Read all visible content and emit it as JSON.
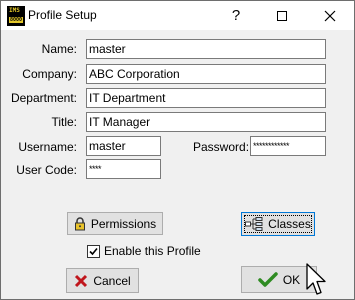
{
  "window": {
    "title": "Profile Setup",
    "icon": "ims-app-icon",
    "icon_text_top": "IMS",
    "icon_text_bottom": "8000"
  },
  "titlebar": {
    "help_label": "?",
    "minimize": "minimize-icon",
    "maximize": "maximize-icon",
    "close": "close-icon"
  },
  "form": {
    "name_label": "Name:",
    "name_value": "master",
    "company_label": "Company:",
    "company_value": "ABC Corporation",
    "department_label": "Department:",
    "department_value": "IT Department",
    "title_label": "Title:",
    "title_value": "IT Manager",
    "username_label": "Username:",
    "username_value": "master",
    "password_label": "Password:",
    "password_value": "************",
    "usercode_label": "User Code:",
    "usercode_value": "****"
  },
  "buttons": {
    "permissions_label": "Permissions",
    "classes_label": "Classes",
    "cancel_label": "Cancel",
    "ok_label": "OK"
  },
  "options": {
    "enable_profile_label": "Enable this Profile",
    "enable_profile_checked": true
  },
  "colors": {
    "cancel_x": "#c0161c",
    "ok_check": "#2e8b22",
    "focus_border": "#0078d7"
  }
}
